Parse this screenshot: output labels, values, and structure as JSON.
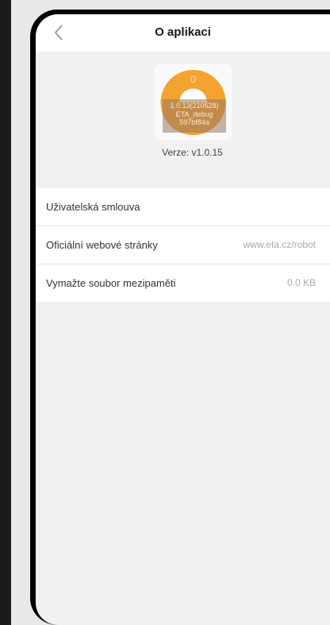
{
  "header": {
    "title": "O aplikaci",
    "back_icon": "chevron-left-icon"
  },
  "app_icon": {
    "counter": "0",
    "debug_lines": [
      "1.0.13(210528)",
      "ETA_debug",
      "597bf84a"
    ],
    "color": "#f5a32f"
  },
  "version": "Verze: v1.0.15",
  "settings": [
    {
      "label": "Uživatelská smlouva",
      "value": ""
    },
    {
      "label": "Oficiální webové stránky",
      "value": "www.eta.cz/robot"
    },
    {
      "label": "Vymažte soubor mezipaměti",
      "value": "0.0 KB"
    }
  ]
}
